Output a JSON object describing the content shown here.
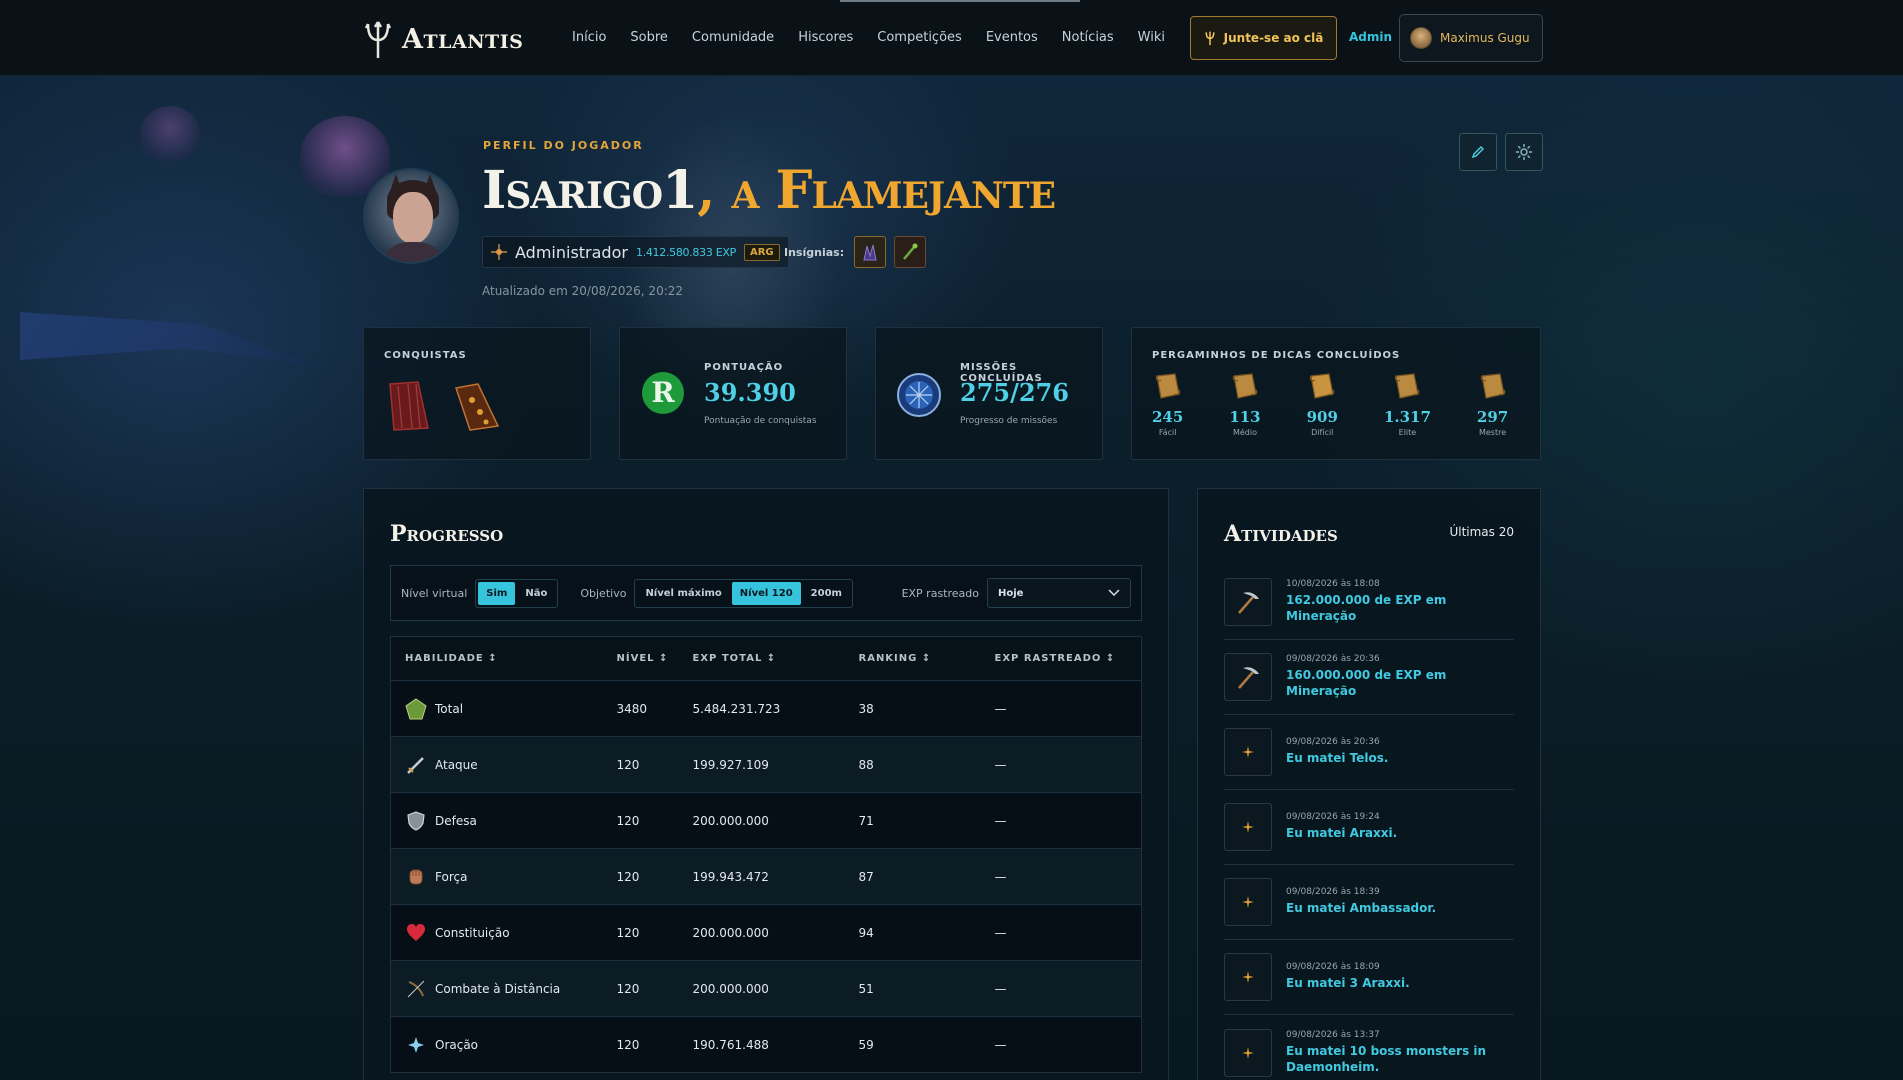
{
  "colors": {
    "accent": "#35c4dc",
    "gold": "#f0a730",
    "background": "#08141c"
  },
  "header": {
    "logo_text": "Atlantis",
    "nav": [
      "Início",
      "Sobre",
      "Comunidade",
      "Hiscores",
      "Competições",
      "Eventos",
      "Notícias",
      "Wiki"
    ],
    "join_label": "Junte-se ao clã",
    "admin_label": "Admin",
    "user_name": "Maximus Gugu"
  },
  "profile": {
    "eyebrow": "PERFIL DO JOGADOR",
    "name": "Isarigo1",
    "title": ", a Flamejante",
    "rank": "Administrador",
    "exp": "1.412.580.833 EXP",
    "tag": "ARG",
    "badges_label": "Insígnias:",
    "updated": "Atualizado em 20/08/2026, 20:22"
  },
  "cards": {
    "conquistas": {
      "title": "CONQUISTAS"
    },
    "pontuacao": {
      "title": "PONTUAÇÃO",
      "value": "39.390",
      "sub": "Pontuação de conquistas"
    },
    "missoes": {
      "title": "MISSÕES CONCLUÍDAS",
      "value": "275/276",
      "sub": "Progresso de missões"
    },
    "pergaminhos": {
      "title": "PERGAMINHOS DE DICAS CONCLUÍDOS",
      "items": [
        {
          "value": "245",
          "label": "Fácil"
        },
        {
          "value": "113",
          "label": "Médio"
        },
        {
          "value": "909",
          "label": "Difícil"
        },
        {
          "value": "1.317",
          "label": "Elite"
        },
        {
          "value": "297",
          "label": "Mestre"
        }
      ]
    }
  },
  "progress": {
    "title": "Progresso",
    "filters": {
      "virtual_label": "Nível virtual",
      "virtual_yes": "Sim",
      "virtual_no": "Não",
      "goal_label": "Objetivo",
      "goal_max": "Nível máximo",
      "goal_120": "Nível 120",
      "goal_200m": "200m",
      "tracked_label": "EXP rastreado",
      "tracked_value": "Hoje"
    },
    "columns": [
      "HABILIDADE ↕",
      "NÍVEL ↕",
      "EXP TOTAL ↕",
      "RANKING ↕",
      "EXP RASTREADO ↕"
    ],
    "rows": [
      {
        "skill": "Total",
        "level": "3480",
        "exp": "5.484.231.723",
        "rank": "38",
        "tracked": "—"
      },
      {
        "skill": "Ataque",
        "level": "120",
        "exp": "199.927.109",
        "rank": "88",
        "tracked": "—"
      },
      {
        "skill": "Defesa",
        "level": "120",
        "exp": "200.000.000",
        "rank": "71",
        "tracked": "—"
      },
      {
        "skill": "Força",
        "level": "120",
        "exp": "199.943.472",
        "rank": "87",
        "tracked": "—"
      },
      {
        "skill": "Constituição",
        "level": "120",
        "exp": "200.000.000",
        "rank": "94",
        "tracked": "—"
      },
      {
        "skill": "Combate à Distância",
        "level": "120",
        "exp": "200.000.000",
        "rank": "51",
        "tracked": "—"
      },
      {
        "skill": "Oração",
        "level": "120",
        "exp": "190.761.488",
        "rank": "59",
        "tracked": "—"
      }
    ]
  },
  "activities": {
    "title": "Atividades",
    "count": "Últimas 20",
    "items": [
      {
        "icon": "pickaxe-icon",
        "date": "10/08/2026 às 18:08",
        "text": "162.000.000 de EXP em Mineração"
      },
      {
        "icon": "pickaxe-icon",
        "date": "09/08/2026 às 20:36",
        "text": "160.000.000 de EXP em Mineração"
      },
      {
        "icon": "sparkle-icon",
        "date": "09/08/2026 às 20:36",
        "text": "Eu matei Telos."
      },
      {
        "icon": "sparkle-icon",
        "date": "09/08/2026 às 19:24",
        "text": "Eu matei Araxxi."
      },
      {
        "icon": "sparkle-icon",
        "date": "09/08/2026 às 18:39",
        "text": "Eu matei Ambassador."
      },
      {
        "icon": "sparkle-icon",
        "date": "09/08/2026 às 18:09",
        "text": "Eu matei 3 Araxxi."
      },
      {
        "icon": "sparkle-icon",
        "date": "09/08/2026 às 13:37",
        "text": "Eu matei 10 boss monsters in Daemonheim."
      }
    ]
  }
}
